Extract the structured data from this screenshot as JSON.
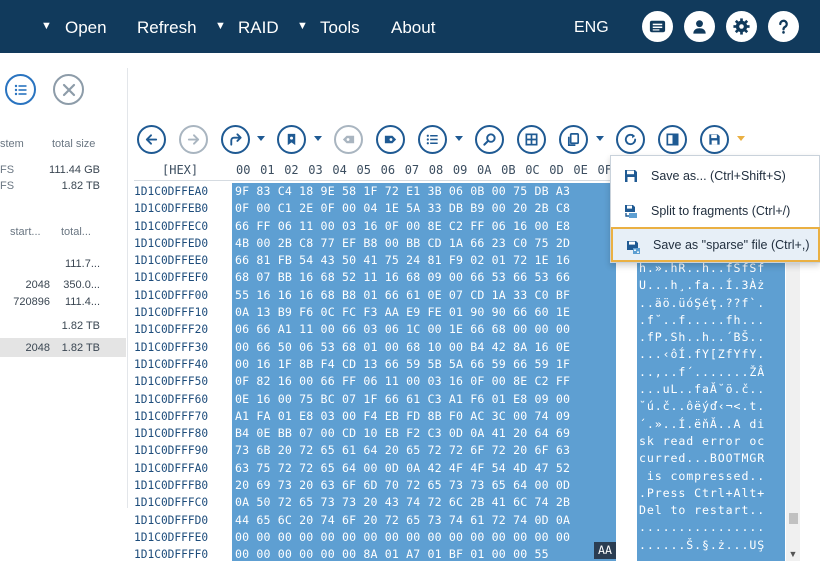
{
  "menu": {
    "open": "Open",
    "refresh": "Refresh",
    "raid": "RAID",
    "tools": "Tools",
    "about": "About",
    "language": "ENG"
  },
  "left_panel": {
    "headers": {
      "system": "stem",
      "total_size": "total size"
    },
    "rows": [
      {
        "name": "FS",
        "size": "111.44 GB"
      },
      {
        "name": "FS",
        "size": "1.82 TB"
      }
    ],
    "headers2": {
      "start": "start...",
      "total": "total..."
    },
    "rows2": [
      {
        "start": "",
        "total": "111.7..."
      },
      {
        "start": "2048",
        "total": "350.0..."
      },
      {
        "start": "720896",
        "total": "111.4..."
      },
      {
        "start": "",
        "total": "1.82 TB"
      },
      {
        "start": "2048",
        "total": "1.82 TB"
      }
    ]
  },
  "hex_view": {
    "offset_header": "[HEX]",
    "columns": [
      "00",
      "01",
      "02",
      "03",
      "04",
      "05",
      "06",
      "07",
      "08",
      "09",
      "0A",
      "0B",
      "0C",
      "0D",
      "0E",
      "0F"
    ],
    "offsets": [
      "1D1C0DFFEA0",
      "1D1C0DFFEB0",
      "1D1C0DFFEC0",
      "1D1C0DFFED0",
      "1D1C0DFFEE0",
      "1D1C0DFFEF0",
      "1D1C0DFFF00",
      "1D1C0DFFF10",
      "1D1C0DFFF20",
      "1D1C0DFFF30",
      "1D1C0DFFF40",
      "1D1C0DFFF50",
      "1D1C0DFFF60",
      "1D1C0DFFF70",
      "1D1C0DFFF80",
      "1D1C0DFFF90",
      "1D1C0DFFFA0",
      "1D1C0DFFFB0",
      "1D1C0DFFFC0",
      "1D1C0DFFFD0",
      "1D1C0DFFFE0",
      "1D1C0DFFFF0"
    ],
    "rows": [
      "9F 83 C4 18 9E 58 1F 72 E1 3B 06 0B 00 75 DB A3",
      "0F 00 C1 2E 0F 00 04 1E 5A 33 DB B9 00 20 2B C8",
      "66 FF 06 11 00 03 16 0F 00 8E C2 FF 06 16 00 E8",
      "4B 00 2B C8 77 EF B8 00 BB CD 1A 66 23 C0 75 2D",
      "66 81 FB 54 43 50 41 75 24 81 F9 02 01 72 1E 16",
      "68 07 BB 16 68 52 11 16 68 09 00 66 53 66 53 66",
      "55 16 16 16 68 B8 01 66 61 0E 07 CD 1A 33 C0 BF",
      "0A 13 B9 F6 0C FC F3 AA E9 FE 01 90 90 66 60 1E",
      "06 66 A1 11 00 66 03 06 1C 00 1E 66 68 00 00 00",
      "00 66 50 06 53 68 01 00 68 10 00 B4 42 8A 16 0E",
      "00 16 1F 8B F4 CD 13 66 59 5B 5A 66 59 66 59 1F",
      "0F 82 16 00 66 FF 06 11 00 03 16 0F 00 8E C2 FF",
      "0E 16 00 75 BC 07 1F 66 61 C3 A1 F6 01 E8 09 00",
      "A1 FA 01 E8 03 00 F4 EB FD 8B F0 AC 3C 00 74 09",
      "B4 0E BB 07 00 CD 10 EB F2 C3 0D 0A 41 20 64 69",
      "73 6B 20 72 65 61 64 20 65 72 72 6F 72 20 6F 63",
      "63 75 72 72 65 64 00 0D 0A 42 4F 4F 54 4D 47 52",
      "20 69 73 20 63 6F 6D 70 72 65 73 73 65 64 00 0D",
      "0A 50 72 65 73 73 20 43 74 72 6C 2B 41 6C 74 2B",
      "44 65 6C 20 74 6F 20 72 65 73 74 61 72 74 0D 0A",
      "00 00 00 00 00 00 00 00 00 00 00 00 00 00 00 00",
      "00 00 00 00 00 00 8A 01 A7 01 BF 01 00 00 55"
    ],
    "last_byte": "AA",
    "ascii_rows": [
      "h.».hR..h..fSfSf",
      "U...h¸.fa..Í.3Àż",
      "..äö.üóŞéţ.??f`.",
      ".f˘..f.....fh...",
      ".fP.Sh..h..´BŠ..",
      "...‹ôÍ.fY[ZfYfY.",
      "..‚..f´.......ŽÂ",
      "...uL..faĂ˘ö.č..",
      "˘ú.č..ôëýď‹¬<.t.",
      "´.»..Í.ëňĂ..A di",
      "sk read error oc",
      "curred...BOOTMGR",
      " is compressed..",
      ".Press Ctrl+Alt+",
      "Del to restart..",
      "................",
      "......Š.§.ż...UŞ"
    ]
  },
  "dropdown": {
    "items": [
      {
        "label": "Save as... (Ctrl+Shift+S)"
      },
      {
        "label": "Split to fragments (Ctrl+/)"
      },
      {
        "label": "Save as \"sparse\" file (Ctrl+,)"
      }
    ]
  },
  "colors": {
    "topbar": "#113a5c",
    "accent": "#1f5a93",
    "selection": "#5e9fd2",
    "highlight_border": "#eab043"
  }
}
